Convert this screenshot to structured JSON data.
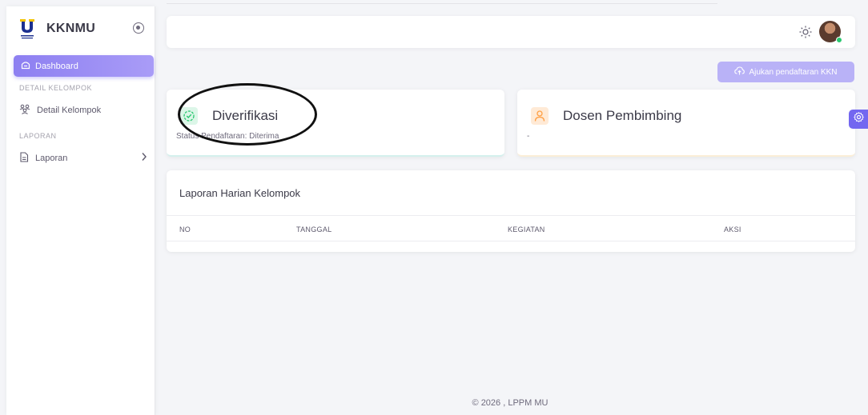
{
  "sidebar": {
    "brand": "KKNMU",
    "items": [
      {
        "label": "Dashboard",
        "icon": "home-icon",
        "active": true
      },
      {
        "section": "DETAIL KELOMPOK"
      },
      {
        "label": "Detail Kelompok",
        "icon": "users-icon"
      },
      {
        "section": "LAPORAN"
      },
      {
        "label": "Laporan",
        "icon": "file-icon",
        "has_submenu": true
      }
    ]
  },
  "header": {
    "theme_icon": "sun-icon",
    "status_color": "#28c76f"
  },
  "actions": {
    "submit_label": "Ajukan pendaftaran KKN",
    "submit_icon": "cloud-upload-icon",
    "accent": "#7367f0"
  },
  "cards": {
    "verification": {
      "title": "Diverifikasi",
      "subtitle": "Status Pendaftaran: Diterima",
      "icon": "check-circle-icon"
    },
    "supervisor": {
      "title": "Dosen Pembimbing",
      "subtitle": "-",
      "icon": "user-icon"
    }
  },
  "report_table": {
    "title": "Laporan Harian Kelompok",
    "columns": [
      "NO",
      "TANGGAL",
      "KEGIATAN",
      "AKSI"
    ],
    "rows": []
  },
  "footer": {
    "text": "© 2026 , LPPM MU"
  }
}
